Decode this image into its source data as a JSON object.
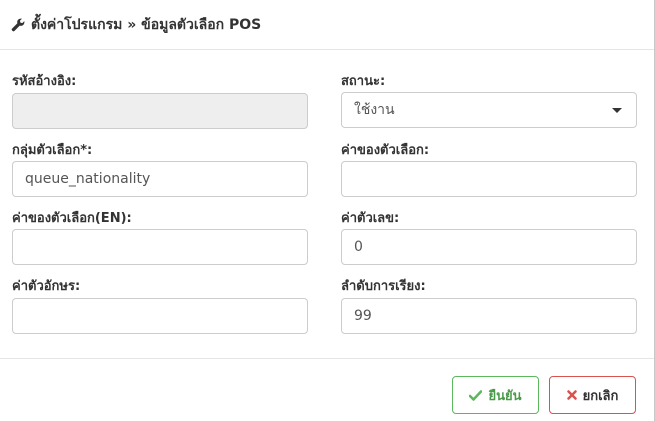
{
  "modal": {
    "title": "ตั้งค่าโปรแกรม » ข้อมูลตัวเลือก POS",
    "icon": "wrench-icon"
  },
  "form": {
    "ref_code": {
      "label": "รหัสอ้างอิง:",
      "value": ""
    },
    "status": {
      "label": "สถานะ:",
      "selected": "ใช้งาน"
    },
    "option_group": {
      "label": "กลุ่มตัวเลือก*:",
      "value": "queue_nationality"
    },
    "option_value": {
      "label": "ค่าของตัวเลือก:",
      "value": ""
    },
    "option_value_en": {
      "label": "ค่าของตัวเลือก(EN):",
      "value": ""
    },
    "numeric_value": {
      "label": "ค่าตัวเลข:",
      "value": "0"
    },
    "text_value": {
      "label": "ค่าตัวอักษร:",
      "value": ""
    },
    "sort_order": {
      "label": "ลำดับการเรียง:",
      "value": "99"
    }
  },
  "footer": {
    "confirm_label": "ยืนยัน",
    "confirm_icon": "check-icon",
    "cancel_label": "ยกเลิก",
    "cancel_icon": "times-icon",
    "confirm_color": "#5cb85c",
    "cancel_color": "#d9534f"
  }
}
